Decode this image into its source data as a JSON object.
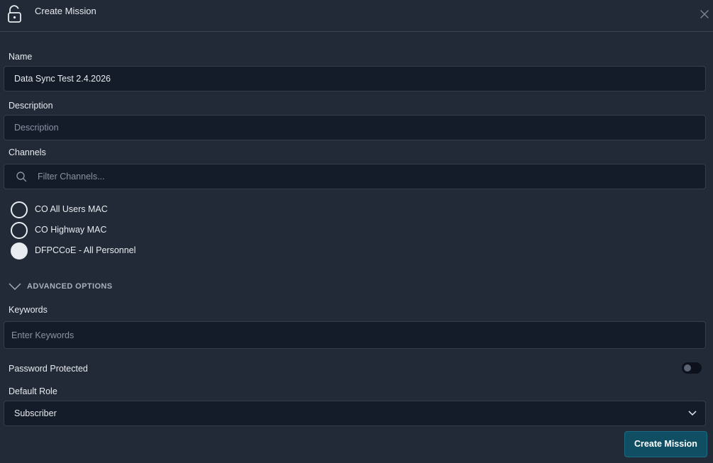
{
  "dialog": {
    "title": "Create Mission",
    "icons": {
      "header": "unlock-icon",
      "close": "close-icon"
    }
  },
  "name": {
    "label": "Name",
    "value": "Data Sync Test 2.4.2026"
  },
  "description": {
    "label": "Description",
    "placeholder": "Description",
    "value": ""
  },
  "channels": {
    "label": "Channels",
    "filter_placeholder": "Filter Channels...",
    "items": [
      {
        "label": "CO All Users MAC",
        "selected": false
      },
      {
        "label": "CO Highway MAC",
        "selected": false
      },
      {
        "label": "DFPCCoE - All Personnel",
        "selected": true
      }
    ]
  },
  "advanced": {
    "label": "ADVANCED OPTIONS",
    "expanded": true
  },
  "keywords": {
    "label": "Keywords",
    "placeholder": "Enter Keywords",
    "value": ""
  },
  "password": {
    "label": "Password Protected",
    "enabled": false
  },
  "default_role": {
    "label": "Default Role",
    "value": "Subscriber"
  },
  "actions": {
    "create_label": "Create Mission"
  },
  "colors": {
    "background": "#222a38",
    "field_background": "#141b29",
    "primary_button": "#0f4e63"
  }
}
